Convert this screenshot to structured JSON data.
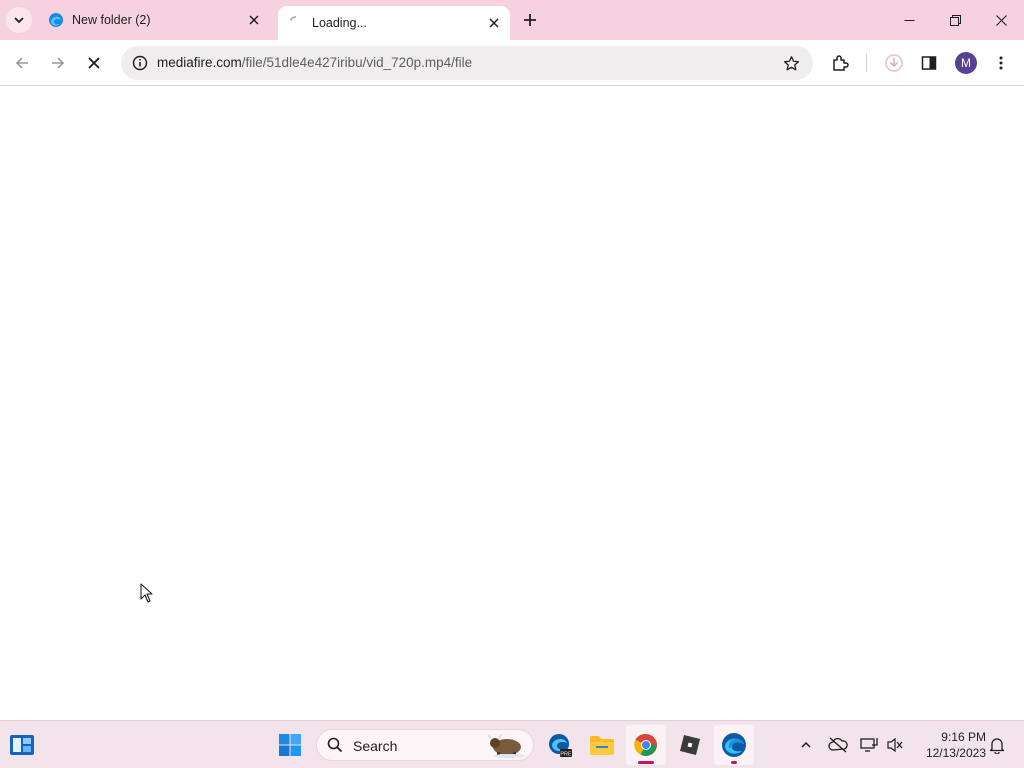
{
  "browser": {
    "tabs": [
      {
        "title": "New folder (2)",
        "state": "inactive",
        "favicon": "edge-icon"
      },
      {
        "title": "Loading...",
        "state": "active",
        "favicon": "loading-spinner-icon"
      }
    ],
    "omnibox": {
      "domain": "mediafire.com",
      "path": "/file/51dle4e427iribu/vid_720p.mp4/file"
    },
    "profile_initial": "M"
  },
  "taskbar": {
    "search_label": "Search",
    "clock": {
      "time": "9:16 PM",
      "date": "12/13/2023"
    }
  },
  "colors": {
    "tabstrip": "#f6d2e0",
    "taskbar": "#f3e3ea",
    "accent": "#c2185b",
    "avatar": "#5a3f97"
  }
}
